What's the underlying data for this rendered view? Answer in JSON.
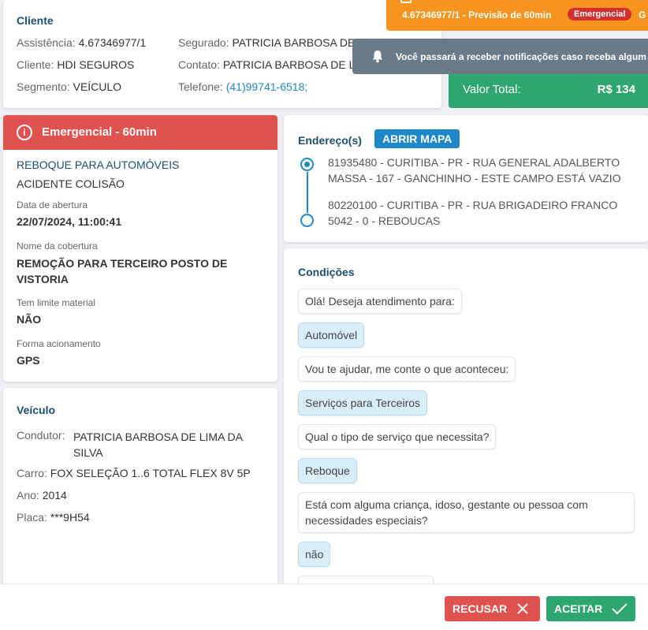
{
  "cliente": {
    "title": "Cliente",
    "assistencia_label": "Assistência:",
    "assistencia_value": "4.67346977/1",
    "cliente_label": "Cliente:",
    "cliente_value": "HDI SEGUROS",
    "segmento_label": "Segmento:",
    "segmento_value": "VEÍCULO",
    "segurado_label": "Segurado:",
    "segurado_value": "PATRICIA BARBOSA DE",
    "contato_label": "Contato:",
    "contato_value": "PATRICIA BARBOSA DE L",
    "telefone_label": "Telefone:",
    "telefone_value": "(41)99741-6518;"
  },
  "banner": {
    "text": "4.67346977/1 - Previsão de 60min",
    "badge": "Emergencial",
    "tail": "G",
    "color": "#f7941d"
  },
  "toast": {
    "icon": "bell-icon",
    "message": "Você passará a receber notificações caso receba algum"
  },
  "valor": {
    "label": "Valor Total:",
    "value": "R$ 134"
  },
  "servico": {
    "header": "Emergencial - 60min",
    "title": "REBOQUE PARA AUTOMÓVEIS",
    "subtitle": "ACIDENTE COLISÃO",
    "data_label": "Data de abertura",
    "data_value": "22/07/2024, 11:00:41",
    "cobertura_label": "Nome da cobertura",
    "cobertura_value": "REMOÇÃO PARA TERCEIRO POSTO DE VISTORIA",
    "limite_label": "Tem limite material",
    "limite_value": "NÃO",
    "acionamento_label": "Forma acionamento",
    "acionamento_value": "GPS"
  },
  "veiculo": {
    "title": "Veículo",
    "condutor_label": "Condutor:",
    "condutor_value": "PATRICIA BARBOSA DE LIMA DA SILVA",
    "carro_label": "Carro:",
    "carro_value": "FOX SELEÇÃO 1..6 TOTAL FLEX 8V 5P",
    "ano_label": "Ano:",
    "ano_value": "2014",
    "placa_label": "Placa:",
    "placa_value": "***9H54"
  },
  "endereco": {
    "title": "Endereço(s)",
    "map_button": "ABRIR MAPA",
    "origem": "81935480 - CURITIBA - PR - RUA GENERAL ADALBERTO MASSA - 167 - GANCHINHO - ESTE CAMPO ESTÁ VAZIO",
    "destino": "80220100 - CURITIBA - PR - RUA BRIGADEIRO FRANCO 5042 - 0 - REBOUCAS"
  },
  "condicoes": {
    "title": "Condições",
    "messages": [
      {
        "text": "Olá! Deseja atendimento para:",
        "type": "question"
      },
      {
        "text": "Automóvel",
        "type": "answer"
      },
      {
        "text": "Vou te ajudar, me conte o que aconteceu:",
        "type": "question"
      },
      {
        "text": "Serviços para Terceiros",
        "type": "answer"
      },
      {
        "text": "Qual o tipo de serviço que necessita?",
        "type": "question"
      },
      {
        "text": "Reboque",
        "type": "answer"
      },
      {
        "text": "Está com alguma criança, idoso, gestante ou pessoa com necessidades especiais?",
        "type": "question"
      },
      {
        "text": "não",
        "type": "answer"
      }
    ]
  },
  "actions": {
    "reject": "RECUSAR",
    "accept": "ACEITAR"
  }
}
